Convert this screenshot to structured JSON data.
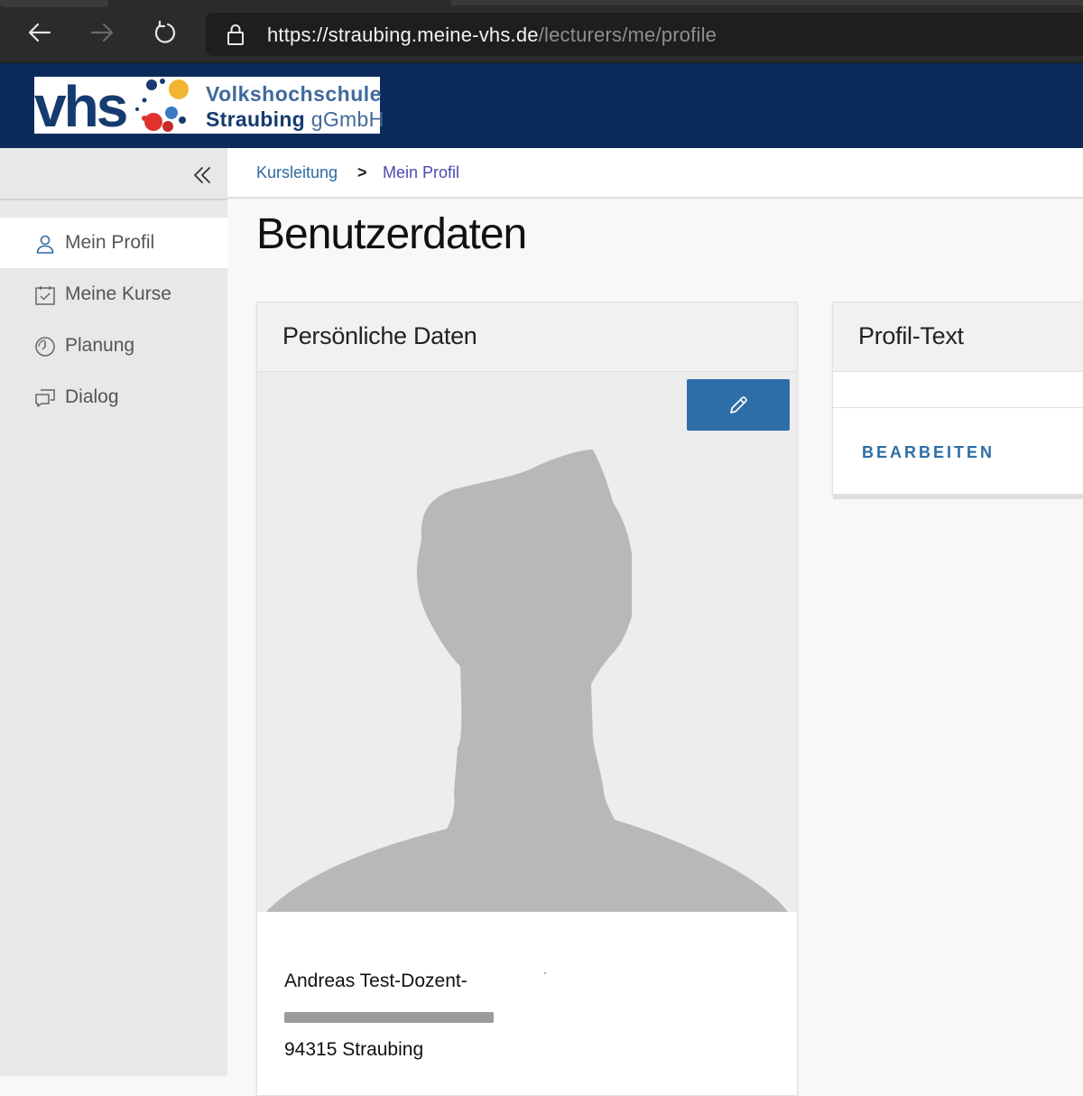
{
  "browser": {
    "url_host": "https://straubing.meine-vhs.de",
    "url_path": "/lecturers/me/profile"
  },
  "logo": {
    "mark": "vhs",
    "line1": "Volkshochschule",
    "line2_main": "Straubing",
    "line2_suffix": "gGmbH"
  },
  "sidebar": {
    "items": [
      {
        "label": "Mein Profil",
        "icon": "user-icon",
        "active": true
      },
      {
        "label": "Meine Kurse",
        "icon": "calendar-check-icon",
        "active": false
      },
      {
        "label": "Planung",
        "icon": "clock-icon",
        "active": false
      },
      {
        "label": "Dialog",
        "icon": "chat-icon",
        "active": false
      }
    ]
  },
  "breadcrumb": {
    "items": [
      "Kursleitung",
      "Mein Profil"
    ],
    "separator": ">"
  },
  "page": {
    "title": "Benutzerdaten"
  },
  "personal": {
    "title": "Persönliche Daten",
    "name": "Andreas Test-Dozent-",
    "city": "94315 Straubing"
  },
  "profile_text": {
    "title": "Profil-Text",
    "edit_label": "BEARBEITEN"
  },
  "colors": {
    "header_bg": "#0c2b5a",
    "accent": "#2d6ea8",
    "sidebar_bg": "#e8e8e8"
  }
}
